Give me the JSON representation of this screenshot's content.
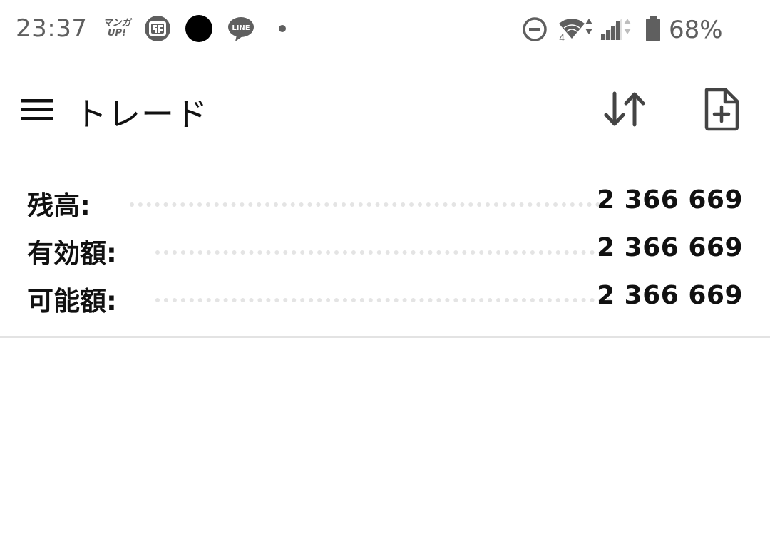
{
  "status_bar": {
    "time": "23:37",
    "manga_icon_line1": "マンガ",
    "manga_icon_line2": "UP!",
    "battery": "68%"
  },
  "app_bar": {
    "title": "トレード",
    "icons": [
      "menu-icon",
      "sort-icon",
      "new-document-icon"
    ]
  },
  "balances": [
    {
      "label": "残高:",
      "value": "2 366 669"
    },
    {
      "label": "有効額:",
      "value": "2 366 669"
    },
    {
      "label": "可能額:",
      "value": "2 366 669"
    }
  ],
  "colors": {
    "status_gray": "#5f5f5f",
    "icon_dark": "#4a4a4a",
    "dots": "#e4e4e4",
    "divider": "#e3e3e3"
  }
}
